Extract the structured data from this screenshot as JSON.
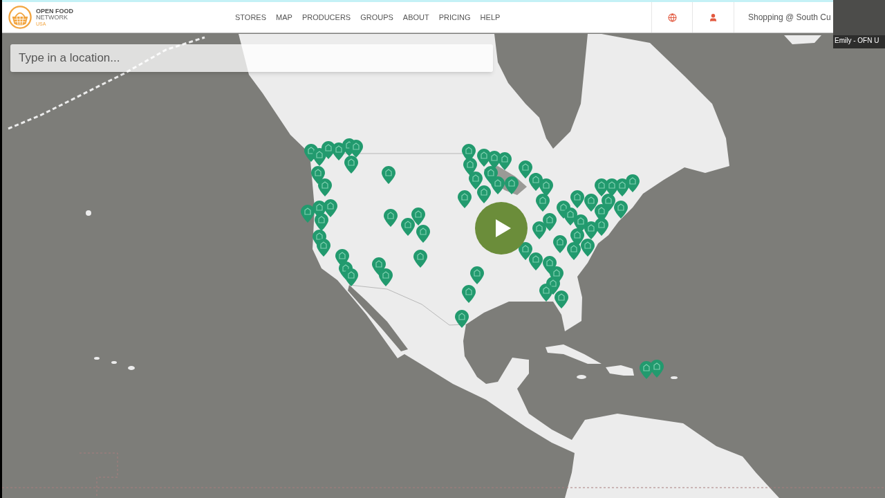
{
  "header": {
    "logo": {
      "line_1": "OPEN FOOD",
      "line_2": "NETWORK",
      "line_3": "USA"
    },
    "nav": [
      "STORES",
      "MAP",
      "PRODUCERS",
      "GROUPS",
      "ABOUT",
      "PRICING",
      "HELP"
    ],
    "shop_label": "Shopping @ South Cu"
  },
  "map": {
    "search": {
      "placeholder": "Type in a location..."
    }
  },
  "video": {
    "participant": "Emily - OFN U"
  }
}
